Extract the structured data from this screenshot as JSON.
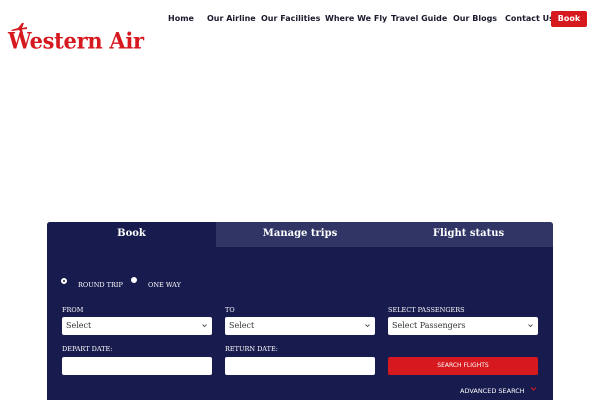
{
  "brand": {
    "name": "Western Air",
    "accent_color": "#d6191f",
    "panel_color": "#181b4e",
    "tabbar_color": "#303565"
  },
  "nav": {
    "items": [
      {
        "label": "Home"
      },
      {
        "label": "Our Airline"
      },
      {
        "label": "Our Facilities"
      },
      {
        "label": "Where We Fly"
      },
      {
        "label": "Travel Guide"
      },
      {
        "label": "Our Blogs"
      },
      {
        "label": "Contact Us"
      }
    ],
    "cta_label": "Book"
  },
  "booking": {
    "tabs": [
      {
        "label": "Book",
        "active": true
      },
      {
        "label": "Manage trips",
        "active": false
      },
      {
        "label": "Flight status",
        "active": false
      }
    ],
    "trip_types": [
      {
        "label": "ROUND TRIP",
        "selected": true
      },
      {
        "label": "ONE WAY",
        "selected": false
      }
    ],
    "from": {
      "label": "FROM",
      "value": "Select"
    },
    "to": {
      "label": "TO",
      "value": "Select"
    },
    "passengers": {
      "label": "SELECT PASSENGERS",
      "value": "Select Passengers"
    },
    "depart": {
      "label": "DEPART DATE:",
      "value": ""
    },
    "return": {
      "label": "RETURN DATE:",
      "value": ""
    },
    "search_label": "SEARCH FLIGHTS",
    "advanced_label": "ADVANCED SEARCH",
    "icons": {
      "select_chevron": "chevron-down-icon",
      "advanced_chevron": "chevron-down-icon",
      "logo_mark": "airplane-icon"
    }
  }
}
